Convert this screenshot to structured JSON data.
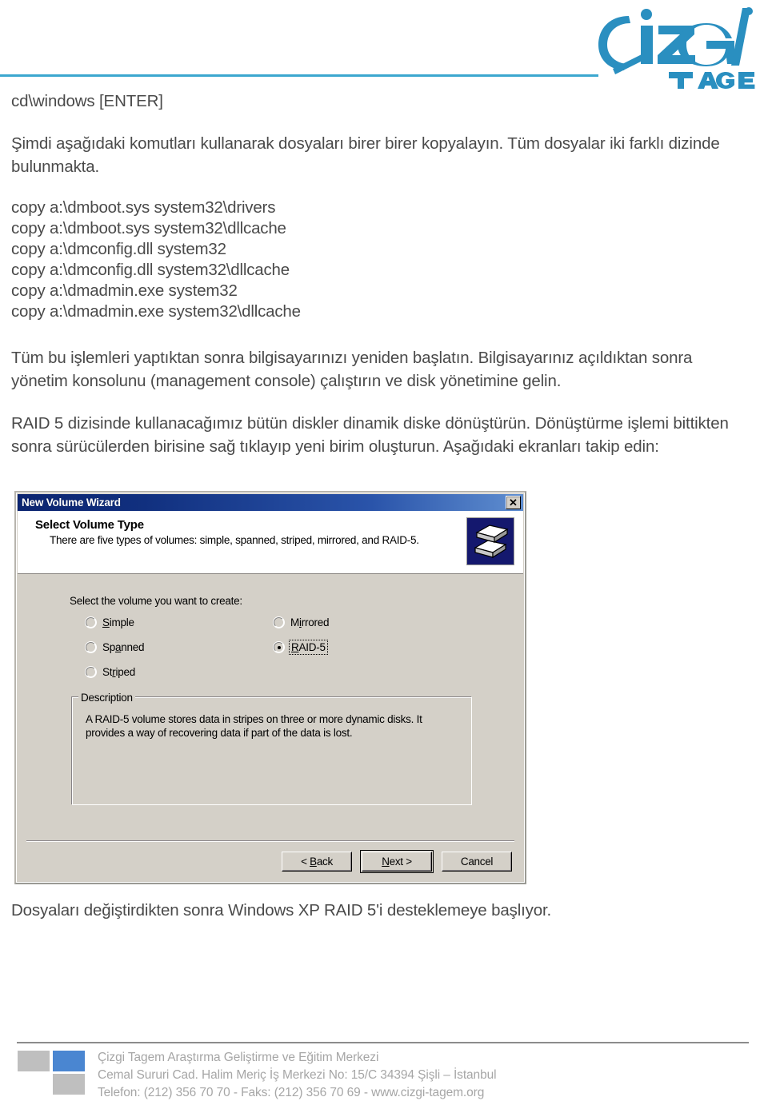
{
  "header": {
    "logo_main": "iZG",
    "logo_lead": "Ç",
    "logo_sub": "TAGEM",
    "brand_color": "#2a8fc0",
    "rule_color": "#3ba7cf"
  },
  "document": {
    "line_cd": "cd\\windows [ENTER]",
    "para_intro": "Şimdi aşağıdaki komutları kullanarak dosyaları birer birer kopyalayın. Tüm dosyalar iki farklı dizinde bulunmakta.",
    "commands": [
      "copy a:\\dmboot.sys system32\\drivers",
      "copy a:\\dmboot.sys system32\\dllcache",
      "copy a:\\dmconfig.dll system32",
      "copy a:\\dmconfig.dll system32\\dllcache",
      "copy a:\\dmadmin.exe system32",
      "copy a:\\dmadmin.exe system32\\dllcache"
    ],
    "para_restart": "Tüm bu işlemleri yaptıktan sonra bilgisayarınızı yeniden başlatın. Bilgisayarınız açıldıktan sonra yönetim konsolunu (management console) çalıştırın ve disk yönetimine gelin.",
    "para_raid": "RAID 5 dizisinde kullanacağımız bütün diskler dinamik diske dönüştürün. Dönüştürme işlemi bittikten sonra sürücülerden birisine sağ tıklayıp yeni birim oluşturun. Aşağıdaki ekranları takip edin:",
    "caption_after_dialog": "Dosyaları değiştirdikten sonra Windows XP RAID 5'i desteklemeye başlıyor."
  },
  "dialog": {
    "title": "New Volume Wizard",
    "close_label": "✕",
    "banner_title": "Select Volume Type",
    "banner_subtitle": "There are five types of volumes: simple, spanned, striped, mirrored, and RAID-5.",
    "prompt": "Select the volume you want to create:",
    "options": [
      {
        "label": "Simple",
        "acc_index": 0,
        "checked": false,
        "focused": false
      },
      {
        "label": "Spanned",
        "acc_index": 2,
        "checked": false,
        "focused": false
      },
      {
        "label": "Striped",
        "acc_index": 2,
        "checked": false,
        "focused": false
      },
      {
        "label": "Mirrored",
        "acc_index": 1,
        "checked": false,
        "focused": false
      },
      {
        "label": "RAID-5",
        "acc_index": 0,
        "checked": true,
        "focused": true
      }
    ],
    "option_labels": {
      "simple": "Simple",
      "spanned": "Spanned",
      "striped": "Striped",
      "mirrored": "Mirrored",
      "raid5": "RAID-5"
    },
    "description_legend": "Description",
    "description_text": "A RAID-5 volume stores data in stripes on three or more dynamic disks. It provides a way of recovering data if part of the data is lost.",
    "buttons": {
      "back": "< Back",
      "next": "Next >",
      "cancel": "Cancel"
    },
    "titlebar_color": "#0b2470",
    "face_color": "#d4d0c8",
    "icon_color": "#14186e"
  },
  "footer": {
    "line1": "Çizgi Tagem Araştırma Geliştirme ve Eğitim Merkezi",
    "line2": "Cemal Sururi Cad. Halim Meriç İş Merkezi No: 15/C 34394 Şişli – İstanbul",
    "line3": "Telefon: (212) 356 70 70 - Faks: (212) 356 70 69 - www.cizgi-tagem.org",
    "square_blue": "#4a86d1",
    "square_gray": "#bfbfbf",
    "text_color": "#a6a6a6"
  }
}
